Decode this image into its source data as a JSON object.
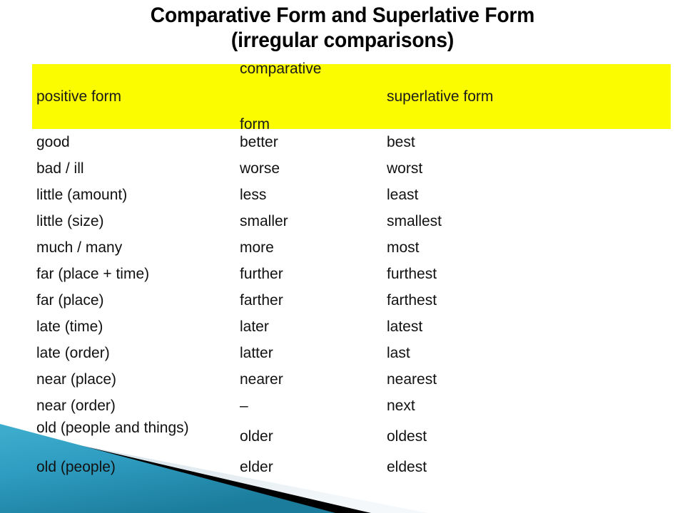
{
  "title": {
    "line1": "Comparative Form and Superlative Form",
    "line2": "(irregular comparisons)"
  },
  "table": {
    "headers": {
      "col1": "positive form",
      "col2_line1": "comparative",
      "col2_line2": "form",
      "col3": "superlative form"
    },
    "rows": [
      {
        "positive": "good",
        "comparative": "better",
        "superlative": "best"
      },
      {
        "positive": "bad / ill",
        "comparative": "worse",
        "superlative": "worst"
      },
      {
        "positive": "little (amount)",
        "comparative": "less",
        "superlative": "least"
      },
      {
        "positive": "little (size)",
        "comparative": "smaller",
        "superlative": "smallest"
      },
      {
        "positive": "much / many",
        "comparative": "more",
        "superlative": "most"
      },
      {
        "positive": "far (place + time)",
        "comparative": "further",
        "superlative": "furthest"
      },
      {
        "positive": "far (place)",
        "comparative": "farther",
        "superlative": "farthest"
      },
      {
        "positive": "late (time)",
        "comparative": "later",
        "superlative": "latest"
      },
      {
        "positive": "late (order)",
        "comparative": "latter",
        "superlative": "last"
      },
      {
        "positive": "near (place)",
        "comparative": "nearer",
        "superlative": "nearest"
      },
      {
        "positive": "near (order)",
        "comparative": "–",
        "superlative": "next"
      },
      {
        "positive": "old (people and things)",
        "comparative": "older",
        "superlative": "oldest"
      },
      {
        "positive": "old (people)",
        "comparative": "elder",
        "superlative": "eldest"
      }
    ]
  },
  "colors": {
    "header_band": "#FCFC00",
    "text": "#111111",
    "deco_teal_light": "#3FA8CC",
    "deco_teal_dark": "#1E7E9E",
    "deco_black": "#000000",
    "deco_pale": "#DCE6EC",
    "background": "#FFFFFF"
  }
}
